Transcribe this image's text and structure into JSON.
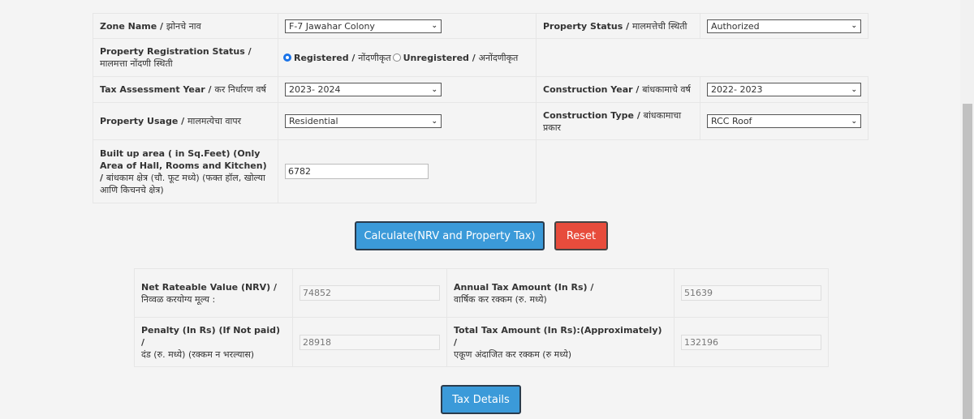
{
  "form": {
    "zone": {
      "label": "Zone Name / ",
      "label_mr": "झोनचे नाव",
      "value": "F-7 Jawahar Colony"
    },
    "property_status": {
      "label": "Property Status / ",
      "label_mr": "मालमत्तेची स्थिती",
      "value": "Authorized"
    },
    "registration": {
      "label": "Property Registration Status /",
      "label_mr": "मालमत्ता नोंदणी स्थिती",
      "options": [
        {
          "label": "Registered / ",
          "label_mr": "नोंदणीकृत",
          "selected": true
        },
        {
          "label": "Unregistered / ",
          "label_mr": "अनोंदणीकृत",
          "selected": false
        }
      ]
    },
    "tax_year": {
      "label": "Tax Assessment Year / ",
      "label_mr": "कर निर्धारण वर्ष",
      "value": "2023- 2024"
    },
    "construction_year": {
      "label": "Construction Year / ",
      "label_mr": "बांधकामाचे वर्ष",
      "value": "2022- 2023"
    },
    "usage": {
      "label": "Property Usage / ",
      "label_mr": "मालमत्येचा वापर",
      "value": "Residential"
    },
    "construction_type": {
      "label": "Construction Type / ",
      "label_mr": "बांधकामाचा प्रकार",
      "value": "RCC Roof"
    },
    "built_up": {
      "label": "Built up area ( in Sq.Feet) (Only Area of Hall, Rooms and Kitchen) /",
      "label_mr": "बांधकाम क्षेत्र (चौ. फूट मध्ये) (फक्त हॉल, खोल्या आणि किचनचे क्षेत्र)",
      "value": "6782"
    }
  },
  "buttons": {
    "calculate": "Calculate(NRV and Property Tax)",
    "reset": "Reset",
    "tax_details": "Tax Details"
  },
  "results": {
    "nrv": {
      "label": "Net Rateable Value (NRV) /",
      "label_mr": "निव्वळ करयोग्य मूल्य :",
      "value": "74852"
    },
    "annual": {
      "label": "Annual Tax Amount (In Rs) /",
      "label_mr": "वार्षिक कर रक्कम (रु. मध्ये)",
      "value": "51639"
    },
    "penalty": {
      "label": "Penalty (In Rs) (If Not paid) /",
      "label_mr": "दंड (रु. मध्ये) (रक्कम न भरल्यास)",
      "value": "28918"
    },
    "total": {
      "label": "Total Tax Amount (In Rs):(Approximately) /",
      "label_mr": "एकूण अंदाजित कर रक्कम (रु मध्ये)",
      "value": "132196"
    }
  },
  "colors": {
    "primary": "#3b9ad9",
    "danger": "#e74c3c"
  }
}
